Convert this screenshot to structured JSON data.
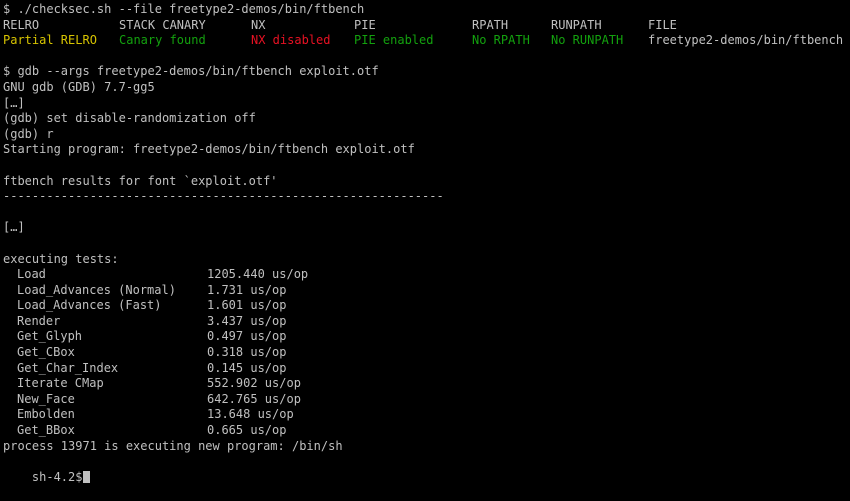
{
  "cmd_checksec": "$ ./checksec.sh --file freetype2-demos/bin/ftbench",
  "checksec": {
    "headers": [
      "RELRO",
      "STACK CANARY",
      "NX",
      "PIE",
      "RPATH",
      "RUNPATH",
      "FILE"
    ],
    "values": [
      "Partial RELRO",
      "Canary found",
      "NX disabled",
      "PIE enabled",
      "No RPATH",
      "No RUNPATH",
      "freetype2-demos/bin/ftbench"
    ]
  },
  "cmd_gdb": "$ gdb --args freetype2-demos/bin/ftbench exploit.otf",
  "gdb_version": "GNU gdb (GDB) 7.7-gg5",
  "ellipsis": "[…]",
  "gdb_cmd1": "(gdb) set disable-randomization off",
  "gdb_cmd2": "(gdb) r",
  "starting": "Starting program: freetype2-demos/bin/ftbench exploit.otf",
  "results_title": "ftbench results for font `exploit.otf'",
  "separator": "-------------------------------------------------------------",
  "executing_title": "executing tests:",
  "tests": [
    {
      "name": "Load",
      "value": "1205.440 us/op"
    },
    {
      "name": "Load_Advances (Normal)",
      "value": "1.731 us/op"
    },
    {
      "name": "Load_Advances (Fast)",
      "value": "1.601 us/op"
    },
    {
      "name": "Render",
      "value": "3.437 us/op"
    },
    {
      "name": "Get_Glyph",
      "value": "0.497 us/op"
    },
    {
      "name": "Get_CBox",
      "value": "0.318 us/op"
    },
    {
      "name": "Get_Char_Index",
      "value": "0.145 us/op"
    },
    {
      "name": "Iterate CMap",
      "value": "552.902 us/op"
    },
    {
      "name": "New_Face",
      "value": "642.765 us/op"
    },
    {
      "name": "Embolden",
      "value": "13.648 us/op"
    },
    {
      "name": "Get_BBox",
      "value": "0.665 us/op"
    }
  ],
  "process_msg": "process 13971 is executing new program: /bin/sh",
  "shell_prompt": "sh-4.2$",
  "colors": {
    "background": "#000000",
    "text": "#c0c0c0",
    "warning": "#d7c400",
    "good": "#13a10e",
    "bad": "#e81123"
  }
}
